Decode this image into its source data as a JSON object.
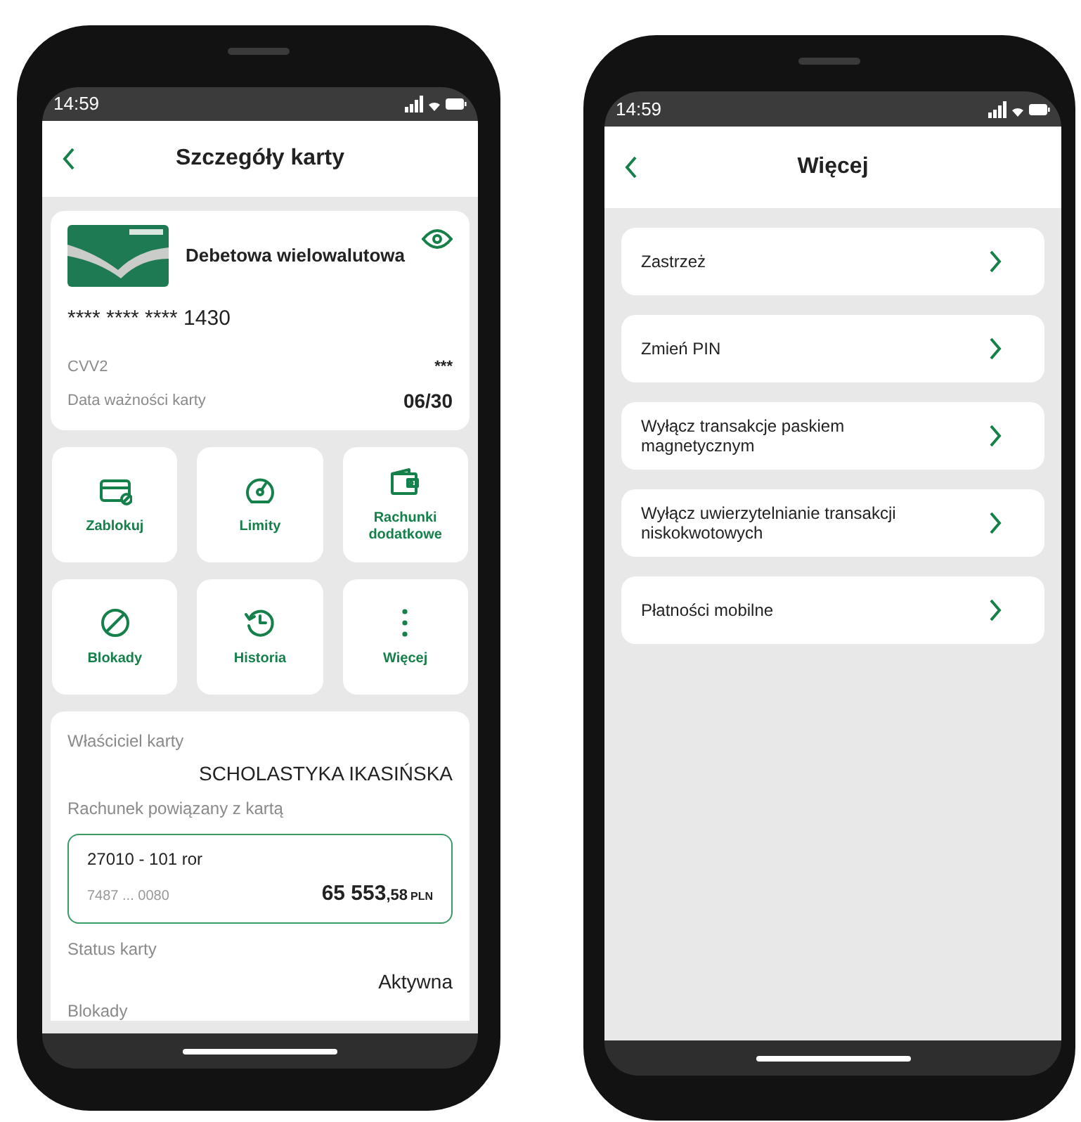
{
  "card_details_screen": {
    "status_bar": {
      "time": "14:59"
    },
    "header": {
      "title": "Szczegóły karty"
    },
    "card": {
      "name": "Debetowa wielowalutowa",
      "number": "**** **** **** 1430",
      "cvv_label": "CVV2",
      "cvv_value": "***",
      "expiry_label": "Data ważności karty",
      "expiry_value": "06/30"
    },
    "actions": [
      {
        "label": "Zablokuj",
        "kind": "card-block"
      },
      {
        "label": "Limity",
        "kind": "gauge"
      },
      {
        "label": "Rachunki dodatkowe",
        "kind": "wallet"
      },
      {
        "label": "Blokady",
        "kind": "prohibit"
      },
      {
        "label": "Historia",
        "kind": "history"
      },
      {
        "label": "Więcej",
        "kind": "more"
      }
    ],
    "details": {
      "owner_label": "Właściciel karty",
      "owner_value": "SCHOLASTYKA IKASIŃSKA",
      "account_label": "Rachunek powiązany z kartą",
      "account": {
        "name": "27010 - 101 ror",
        "number": "7487 ... 0080",
        "amount": "65 553",
        "decimals": ",58",
        "currency": "PLN"
      },
      "status_label": "Status karty",
      "status_value": "Aktywna",
      "blocks_label": "Blokady"
    }
  },
  "more_screen": {
    "status_bar": {
      "time": "14:59"
    },
    "header": {
      "title": "Więcej"
    },
    "options": [
      {
        "label": "Zastrzeż"
      },
      {
        "label": "Zmień PIN"
      },
      {
        "label": "Wyłącz transakcje paskiem magnetycznym"
      },
      {
        "label": "Wyłącz uwierzytelnianie transakcji niskokwotowych"
      },
      {
        "label": "Płatności mobilne"
      }
    ]
  }
}
